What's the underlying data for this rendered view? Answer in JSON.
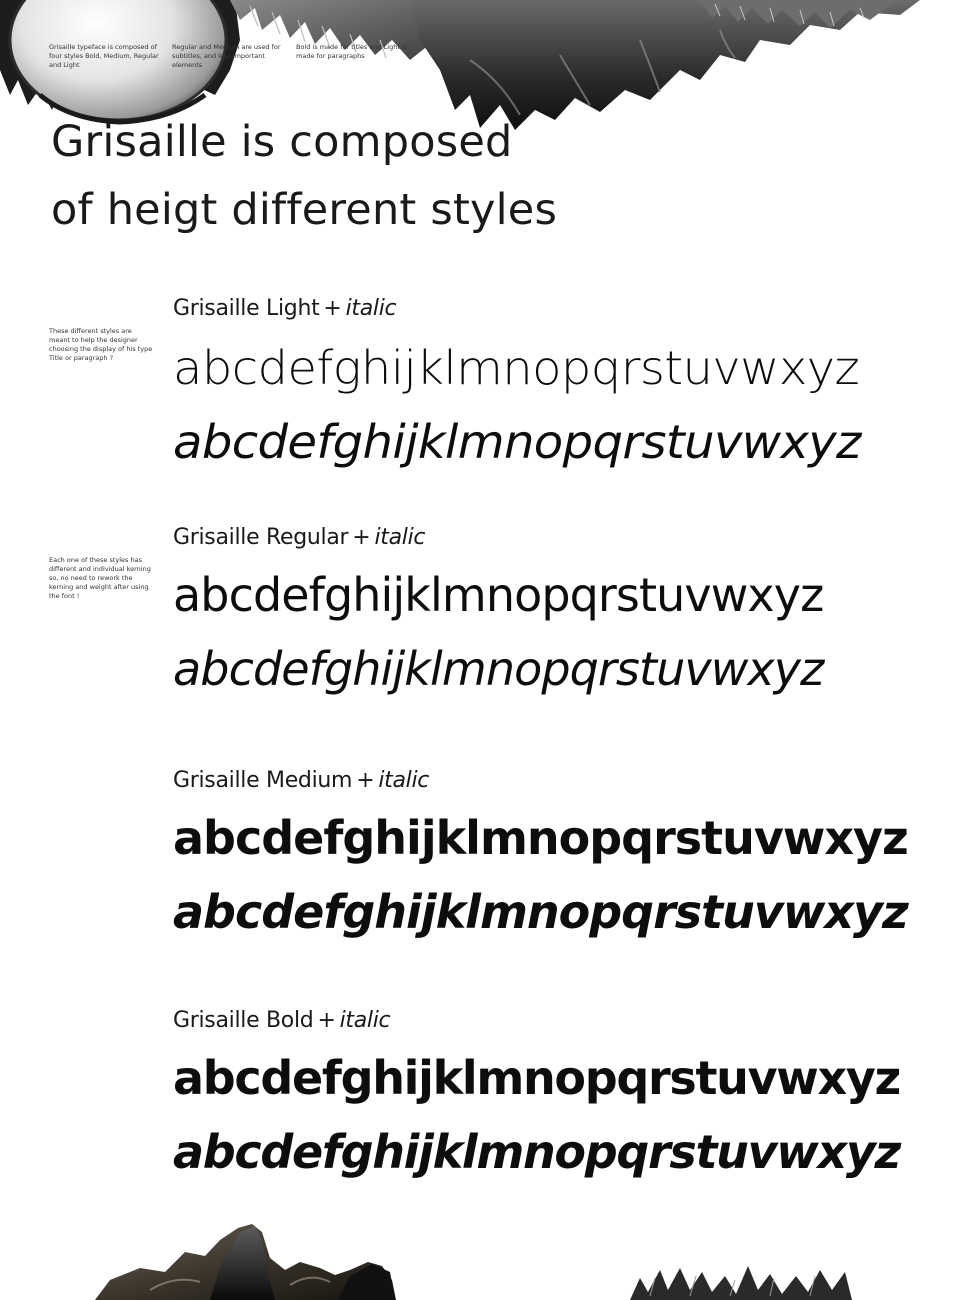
{
  "intro_notes": [
    "Grisaille typeface is composed of four styles Bold, Medium, Regular and Light",
    "Regular and Medium are used for subtitles, and less important elements",
    "Bold is made for titles and Light is made for paragraphs"
  ],
  "headline": {
    "line1": "Grisaille is composed",
    "line2": "of heigt different styles"
  },
  "side_notes": {
    "light": "These different styles are meant to help the designer choosing the display of his type Title or paragraph ?",
    "regular": "Each one of these styles has different and individual kerning so, no need to rework the kerning and weight after using the font !"
  },
  "styles": [
    {
      "name": "Grisaille Light",
      "plus": "+",
      "italic_label": "italic",
      "alphabet": "abcdefghijklmnopqrstuvwxyz"
    },
    {
      "name": "Grisaille Regular",
      "plus": "+",
      "italic_label": "italic",
      "alphabet": "abcdefghijklmnopqrstuvwxyz"
    },
    {
      "name": "Grisaille Medium",
      "plus": "+",
      "italic_label": "italic",
      "alphabet": "abcdefghijklmnopqrstuvwxyz"
    },
    {
      "name": "Grisaille Bold",
      "plus": "+",
      "italic_label": "italic",
      "alphabet": "abcdefghijklmnopqrstuvwxyz"
    }
  ],
  "colors": {
    "background": "#ffffff",
    "text": "#111111",
    "sculpture_dark": "#1e1e1e",
    "sculpture_mid": "#5a5a5a",
    "sculpture_bronze": "#4a4236"
  }
}
